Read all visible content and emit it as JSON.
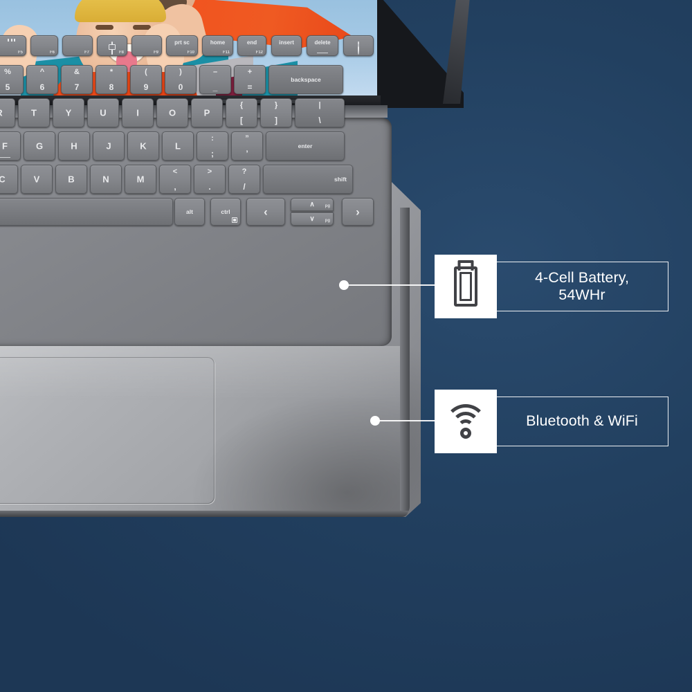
{
  "background": {
    "color": "#224060"
  },
  "product": {
    "type": "laptop",
    "screen_wallpaper": "two-people-portrait-orange-teal",
    "deck_color": "#a9abaf"
  },
  "keyboard": {
    "function_row": [
      {
        "glyph": "keyboard-backlight-icon",
        "sub": "F5"
      },
      {
        "glyph": "brightness-up-icon",
        "sub": "F6"
      },
      {
        "glyph": "brightness-down-icon",
        "sub": "F7"
      },
      {
        "glyph": "display-switch-icon",
        "sub": "F8"
      },
      {
        "glyph": "",
        "sub": "F9"
      },
      {
        "label": "prt sc",
        "sub": "F10"
      },
      {
        "label": "home",
        "sub": "F11"
      },
      {
        "label": "end",
        "sub": "F12"
      },
      {
        "label": "insert",
        "sub": ""
      },
      {
        "label": "delete",
        "sub": ""
      },
      {
        "glyph": "power-icon",
        "sub": ""
      }
    ],
    "number_row": [
      {
        "up": "%",
        "dn": "5"
      },
      {
        "up": "^",
        "dn": "6"
      },
      {
        "up": "&",
        "dn": "7"
      },
      {
        "up": "*",
        "dn": "8"
      },
      {
        "up": "(",
        "dn": "9"
      },
      {
        "up": ")",
        "dn": "0"
      },
      {
        "up": "–",
        "dn": "_"
      },
      {
        "up": "+",
        "dn": "="
      },
      {
        "label": "backspace"
      }
    ],
    "top_row": [
      {
        "label": "R"
      },
      {
        "label": "T"
      },
      {
        "label": "Y"
      },
      {
        "label": "U"
      },
      {
        "label": "I"
      },
      {
        "label": "O"
      },
      {
        "label": "P"
      },
      {
        "up": "{",
        "dn": "["
      },
      {
        "up": "}",
        "dn": "]"
      },
      {
        "up": "|",
        "dn": "\\"
      }
    ],
    "home_row": [
      {
        "label": "F"
      },
      {
        "label": "G"
      },
      {
        "label": "H"
      },
      {
        "label": "J"
      },
      {
        "label": "K"
      },
      {
        "label": "L"
      },
      {
        "up": ":",
        "dn": ";"
      },
      {
        "up": "”",
        "dn": "’"
      },
      {
        "label": "enter"
      }
    ],
    "bottom_letter_row": [
      {
        "label": "C"
      },
      {
        "label": "V"
      },
      {
        "label": "B"
      },
      {
        "label": "N"
      },
      {
        "label": "M"
      },
      {
        "up": "<",
        "dn": ","
      },
      {
        "up": ">",
        "dn": "."
      },
      {
        "up": "?",
        "dn": "/"
      },
      {
        "label": "shift"
      }
    ],
    "modifier_row": [
      {
        "label": "alt"
      },
      {
        "label": "ctrl",
        "glyph": "menu-icon"
      },
      {
        "glyph": "arrow-left-icon"
      },
      {
        "glyph": "arrow-up-icon",
        "sub": "pg"
      },
      {
        "glyph": "arrow-down-icon",
        "sub": "pg"
      },
      {
        "glyph": "arrow-right-icon"
      }
    ]
  },
  "callouts": [
    {
      "id": "battery",
      "icon": "battery-icon",
      "text": "4-Cell Battery,\n54WHr",
      "anchor": "shift-key"
    },
    {
      "id": "connectivity",
      "icon": "wifi-icon",
      "text": "Bluetooth & WiFi",
      "anchor": "palm-rest"
    }
  ],
  "colors": {
    "background": "#224060",
    "callout_box": "#ffffff",
    "callout_text": "#ffffff",
    "icon_stroke": "#414246"
  }
}
